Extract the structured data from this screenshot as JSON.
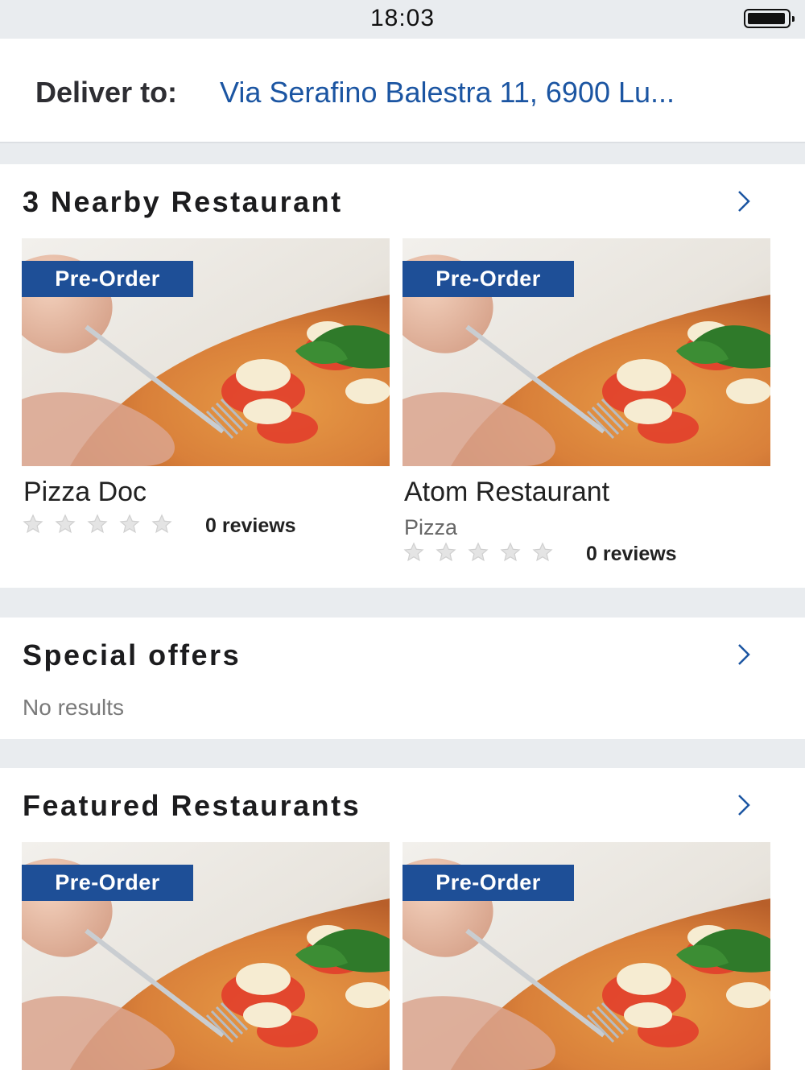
{
  "status_bar": {
    "time": "18:03"
  },
  "delivery": {
    "label": "Deliver to:",
    "address": "Via Serafino Balestra 11, 6900 Lu..."
  },
  "nearby": {
    "title": "3 Nearby Restaurant",
    "restaurants": [
      {
        "badge": "Pre-Order",
        "name": "Pizza Doc",
        "cuisine": "",
        "rating": 0,
        "reviews": "0 reviews"
      },
      {
        "badge": "Pre-Order",
        "name": "Atom Restaurant",
        "cuisine": "Pizza",
        "rating": 0,
        "reviews": "0 reviews"
      }
    ]
  },
  "special_offers": {
    "title": "Special offers",
    "empty_text": "No results"
  },
  "featured": {
    "title": "Featured Restaurants",
    "restaurants": [
      {
        "badge": "Pre-Order"
      },
      {
        "badge": "Pre-Order"
      }
    ]
  },
  "colors": {
    "accent": "#1e4f97",
    "link": "#1b55a2",
    "background": "#e9ecef"
  },
  "icons": [
    "battery-icon",
    "chevron-right-icon",
    "star-icon"
  ]
}
